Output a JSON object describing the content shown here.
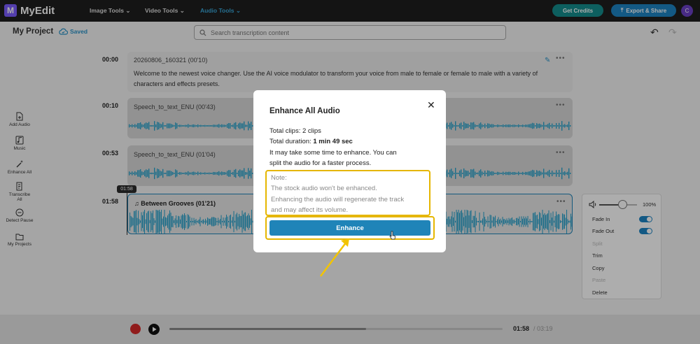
{
  "app": {
    "logo_letter": "M",
    "name": "MyEdit"
  },
  "nav": {
    "items": [
      {
        "label": "Image Tools",
        "active": false
      },
      {
        "label": "Video Tools",
        "active": false
      },
      {
        "label": "Audio Tools",
        "active": true
      }
    ]
  },
  "header": {
    "credits_label": "Get Credits",
    "export_label": "Export & Share",
    "avatar_letter": "C"
  },
  "project": {
    "title": "My Project",
    "saved_label": "Saved",
    "search_placeholder": "Search transcription content"
  },
  "sidebar": {
    "items": [
      {
        "label": "Add Audio",
        "icon": "add-audio-icon"
      },
      {
        "label": "Music",
        "icon": "music-icon"
      },
      {
        "label": "Enhance All",
        "icon": "magic-wand-icon"
      },
      {
        "label": "Transcribe All",
        "icon": "transcribe-icon"
      },
      {
        "label": "Detect Pause",
        "icon": "pause-icon"
      },
      {
        "label": "My Projects",
        "icon": "folder-icon"
      }
    ]
  },
  "timeline": {
    "rows": [
      {
        "time": "00:00",
        "title": "20260806_160321 (00'10)",
        "text": "Welcome to the newest voice changer. Use the AI voice modulator to transform your voice from male to female or female to male with a variety of characters and effects presets."
      },
      {
        "time": "00:10",
        "title": "Speech_to_text_ENU (00'43)"
      },
      {
        "time": "00:53",
        "title": "Speech_to_text_ENU (01'04)"
      },
      {
        "time": "01:58",
        "title": "Between Grooves (01'21)"
      }
    ],
    "playhead_label": "01:58"
  },
  "clip_panel": {
    "volume_pct": "100%",
    "volume_level": 0.62,
    "items": [
      {
        "label": "Fade In",
        "toggle": true,
        "enabled": true
      },
      {
        "label": "Fade Out",
        "toggle": true,
        "enabled": true
      },
      {
        "label": "Split",
        "toggle": false,
        "enabled": false
      },
      {
        "label": "Trim",
        "toggle": false,
        "enabled": true
      },
      {
        "label": "Copy",
        "toggle": false,
        "enabled": true
      },
      {
        "label": "Paste",
        "toggle": false,
        "enabled": false
      },
      {
        "label": "Delete",
        "toggle": false,
        "enabled": true
      }
    ]
  },
  "player": {
    "current_time": "01:58",
    "total_time": "/ 03:19",
    "progress": 0.59
  },
  "modal": {
    "title": "Enhance All Audio",
    "clips_label": "Total clips: 2 clips",
    "duration_prefix": "Total duration: ",
    "duration_value": "1 min 49 sec",
    "info_line1": "It may take some time to enhance. You can",
    "info_line2": "split the audio for a faster process.",
    "note_title": "Note:",
    "note_line1": "The stock audio won't be enhanced.",
    "note_line2": "Enhancing the audio will regenerate the track",
    "note_line3": "and may affect its volume.",
    "button_label": "Enhance"
  },
  "colors": {
    "accent": "#1f84b8",
    "highlight": "#e5b600",
    "waveform": "#2aa3cc",
    "credits": "#148c8c"
  }
}
